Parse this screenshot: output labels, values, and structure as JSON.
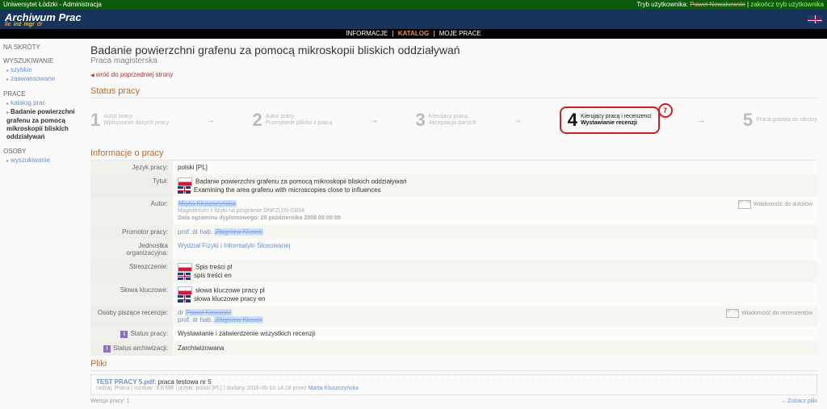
{
  "topbar": {
    "left": "Uniwersytet Łódzki - Administracja",
    "modeLabel": "Tryb użytkownika:",
    "modeUser": "Paweł Nowakowski",
    "end": "zakończ tryb użytkownika"
  },
  "brand": {
    "title": "Archiwum Prac"
  },
  "nav": {
    "info": "INFORMACJE",
    "catalog": "KATALOG",
    "my": "MOJE  PRACE"
  },
  "sidebar": {
    "s1": "NA SKRÓTY",
    "s2": "WYSZUKIWANIE",
    "s2a": "szybkie",
    "s2b": "zaawansowane",
    "s3": "PRACE",
    "s3a": "katalog prac",
    "s3b": "Badanie powierzchni grafenu za pomocą mikroskopii bliskich oddziaływań",
    "s4": "OSOBY",
    "s4a": "wyszukiwanie"
  },
  "page": {
    "title": "Badanie powierzchni grafenu za pomocą mikroskopii bliskich oddziaływań",
    "subtitle": "Praca magisterska",
    "back": "wróć do poprzedniej strony",
    "statusH": "Status pracy",
    "infoH": "Informacje o pracy",
    "filesH": "Pliki"
  },
  "steps": {
    "s1": {
      "n": "1",
      "t1": "Autor pracy",
      "t2": "Wpisywanie danych pracy"
    },
    "s2": {
      "n": "2",
      "t1": "Autor pracy",
      "t2": "Przesyłanie plików z pracą"
    },
    "s3": {
      "n": "3",
      "t1": "Kierujący pracą",
      "t2": "Akceptacja danych"
    },
    "s4": {
      "n": "4",
      "t1": "Kierujący pracą i recenzenci",
      "t2": "Wystawianie recenzji"
    },
    "s5": {
      "n": "5",
      "t2": "Praca gotowa do obrony"
    },
    "annot": "7"
  },
  "info": {
    "langL": "Język pracy:",
    "langV": "polski [PL]",
    "titleL": "Tytuł:",
    "titlePL": "Badanie powierzchni grafenu za pomocą mikroskopii bliskich oddziaływań",
    "titleEN": "Examining the area grafenu with microscopies close to influences",
    "authorL": "Autor:",
    "authorName": "Marta Kluszczyńska",
    "authorMeta1": "Magisterium z fizyki na programie DNFZ(15)-03/04",
    "authorMeta2": "Data egzaminu dyplomowego: 28 października 2008 00:00:00",
    "msgAuthors": "Wiadomość do autorów",
    "promL": "Promotor pracy:",
    "promV": "prof. dr hab. Zbigniew Klusek",
    "unitL": "Jednostka organizacyjna:",
    "unitV": "Wydział Fizyki i Informatyki Stosowanej",
    "absL": "Streszczenie:",
    "absPL": "Spis treści pl",
    "absEN": "spis treści en",
    "kwL": "Słowa kluczowe:",
    "kwPL": "słowa kluczowe pracy pl",
    "kwEN": "słowa kluczowe pracy en",
    "revL": "Osoby piszące recenzje:",
    "rev1": "dr Paweł Kowalski",
    "rev2": "prof. dr hab. Zbigniew Klusek",
    "msgRev": "Wiadomość do recenzentów",
    "statL": "Status pracy:",
    "statV": "Wystawianie i zatwierdzenie wszystkich recenzji",
    "archL": "Status archiwizacji:",
    "archV": "Zarchiwizowana"
  },
  "files": {
    "fname": "TEST PRACY 5.pdf:",
    "fdesc": " praca testowa nr 5",
    "fmeta": "rodzaj: Praca | rozmiar: 9,6 MB | języki: polski [PL] | dodany 2016-05-10 14:18 przez ",
    "fuploader": "Marta Kluszczyńska",
    "ver": "Wersja pracy: 1",
    "see": "Zobacz pliki"
  }
}
